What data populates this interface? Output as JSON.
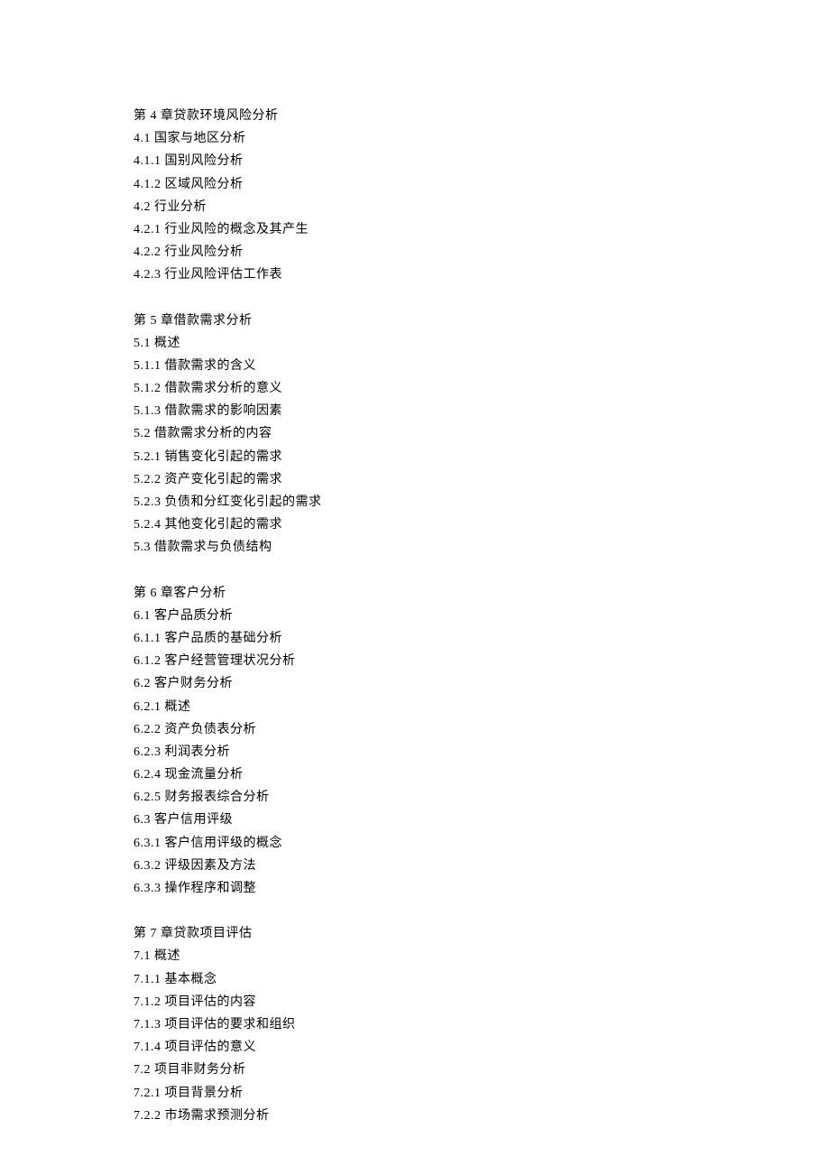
{
  "chapters": [
    {
      "lines": [
        "第 4 章贷款环境风险分析",
        "4.1 国家与地区分析",
        "4.1.1 国别风险分析",
        "4.1.2 区域风险分析",
        "4.2 行业分析",
        "4.2.1 行业风险的概念及其产生",
        "4.2.2 行业风险分析",
        "4.2.3 行业风险评估工作表"
      ]
    },
    {
      "lines": [
        "第 5 章借款需求分析",
        "5.1 概述",
        "5.1.1 借款需求的含义",
        "5.1.2 借款需求分析的意义",
        "5.1.3 借款需求的影响因素",
        "5.2 借款需求分析的内容",
        "5.2.1 销售变化引起的需求",
        "5.2.2 资产变化引起的需求",
        "5.2.3 负债和分红变化引起的需求",
        "5.2.4 其他变化引起的需求",
        "5.3 借款需求与负债结构"
      ]
    },
    {
      "lines": [
        "第 6 章客户分析",
        "6.1 客户品质分析",
        "6.1.1 客户品质的基础分析",
        "6.1.2 客户经营管理状况分析",
        "6.2 客户财务分析",
        "6.2.1 概述",
        "6.2.2 资产负债表分析",
        "6.2.3 利润表分析",
        "6.2.4 现金流量分析",
        "6.2.5 财务报表综合分析",
        "6.3 客户信用评级",
        "6.3.1 客户信用评级的概念",
        "6.3.2 评级因素及方法",
        "6.3.3 操作程序和调整"
      ]
    },
    {
      "lines": [
        "第 7 章贷款项目评估",
        "7.1 概述",
        "7.1.1 基本概念",
        "7.1.2 项目评估的内容",
        "7.1.3 项目评估的要求和组织",
        "7.1.4 项目评估的意义",
        "7.2 项目非财务分析",
        "7.2.1 项目背景分析",
        "7.2.2 市场需求预测分析"
      ]
    }
  ]
}
